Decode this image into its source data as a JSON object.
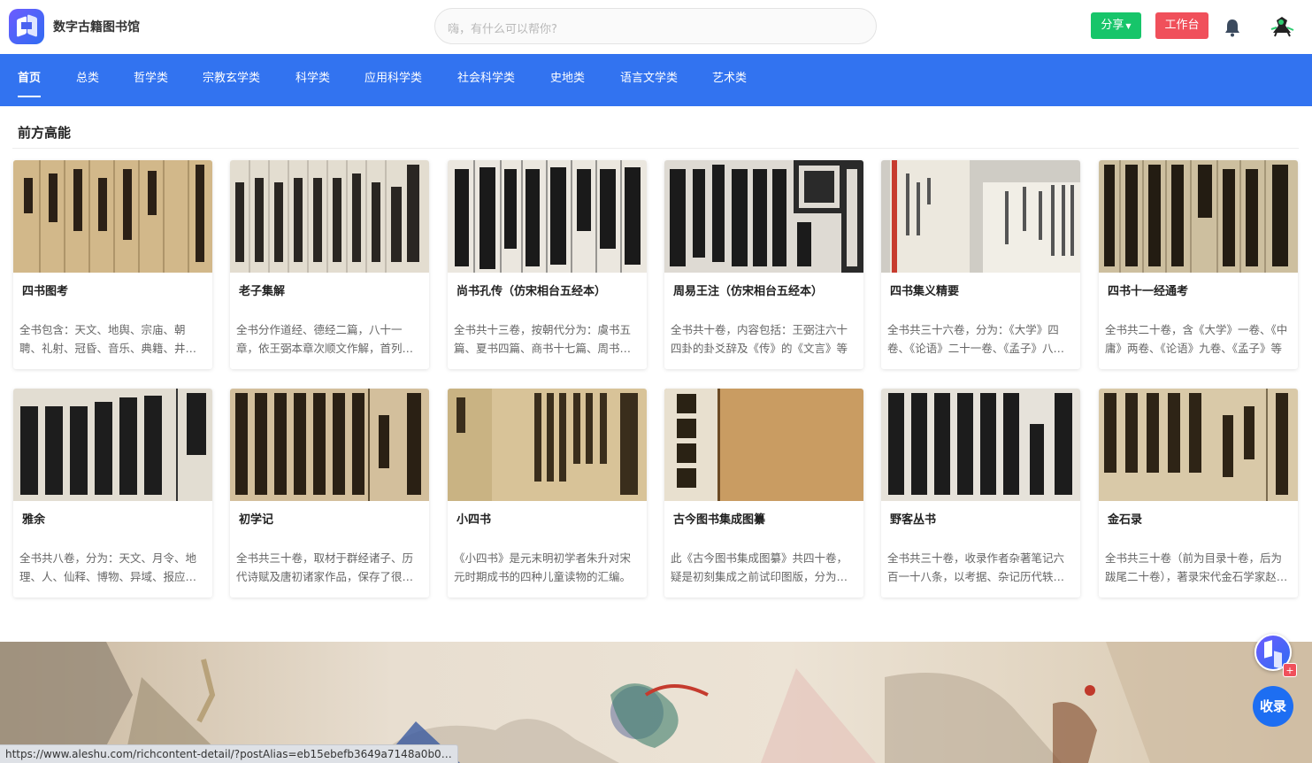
{
  "header": {
    "brand": "数字古籍图书馆",
    "search_placeholder": "嗨，有什么可以帮你?",
    "share_label": "分享",
    "workbench_label": "工作台"
  },
  "nav": {
    "items": [
      "首页",
      "总类",
      "哲学类",
      "宗教玄学类",
      "科学类",
      "应用科学类",
      "社会科学类",
      "史地类",
      "语言文学类",
      "艺术类"
    ],
    "active": "首页"
  },
  "section": {
    "title": "前方高能"
  },
  "cards": [
    {
      "title": "四书图考",
      "desc": "全书包含：天文、地舆、宗庙、朝聘、礼射、冠昏、音乐、典籍、井田、官制等"
    },
    {
      "title": "老子集解",
      "desc": "全书分作道经、德经二篇，八十一章，依王弼本章次顺文作解，首列注释"
    },
    {
      "title": "尚书孔传（仿宋相台五经本）",
      "desc": "全书共十三卷，按朝代分为：虞书五篇、夏书四篇、商书十七篇、周书三十二篇"
    },
    {
      "title": "周易王注（仿宋相台五经本）",
      "desc": "全书共十卷，内容包括：王弼注六十四卦的卦爻辞及《传》的《文言》等"
    },
    {
      "title": "四书集义精要",
      "desc": "全书共三十六卷，分为：《大学》四卷、《论语》二十一卷、《孟子》八卷等"
    },
    {
      "title": "四书十一经通考",
      "desc": "全书共二十卷，含《大学》一卷、《中庸》两卷、《论语》九卷、《孟子》等"
    },
    {
      "title": "雅余",
      "desc": "全书共八卷，分为：天文、月令、地理、人、仙释、博物、异域、报应等部"
    },
    {
      "title": "初学记",
      "desc": "全书共三十卷，取材于群经诸子、历代诗赋及唐初诸家作品，保存了很多古代典籍"
    },
    {
      "title": "小四书",
      "desc": "《小四书》是元末明初学者朱升对宋元时期成书的四种儿童读物的汇编。"
    },
    {
      "title": "古今图书集成图纂",
      "desc": "此《古今图书集成图纂》共四十卷，疑是初刻集成之前试印图版，分为多部"
    },
    {
      "title": "野客丛书",
      "desc": "全书共三十卷，收录作者杂著笔记六百一十八条，以考据、杂记历代轶事为主"
    },
    {
      "title": "金石录",
      "desc": "全书共三十卷（前为目录十卷，后为跋尾二十卷），著录宋代金石学家赵明诚所藏"
    }
  ],
  "floating": {
    "plus": "+",
    "collect_label": "收录"
  },
  "statusbar": {
    "url": "https://www.aleshu.com/richcontent-detail/?postAlias=eb15ebefb3649a7148a0b0…"
  },
  "colors": {
    "nav_bg": "#3273f0",
    "share": "#17c56a",
    "workbench": "#f0505b",
    "collect": "#1d6ef2"
  }
}
